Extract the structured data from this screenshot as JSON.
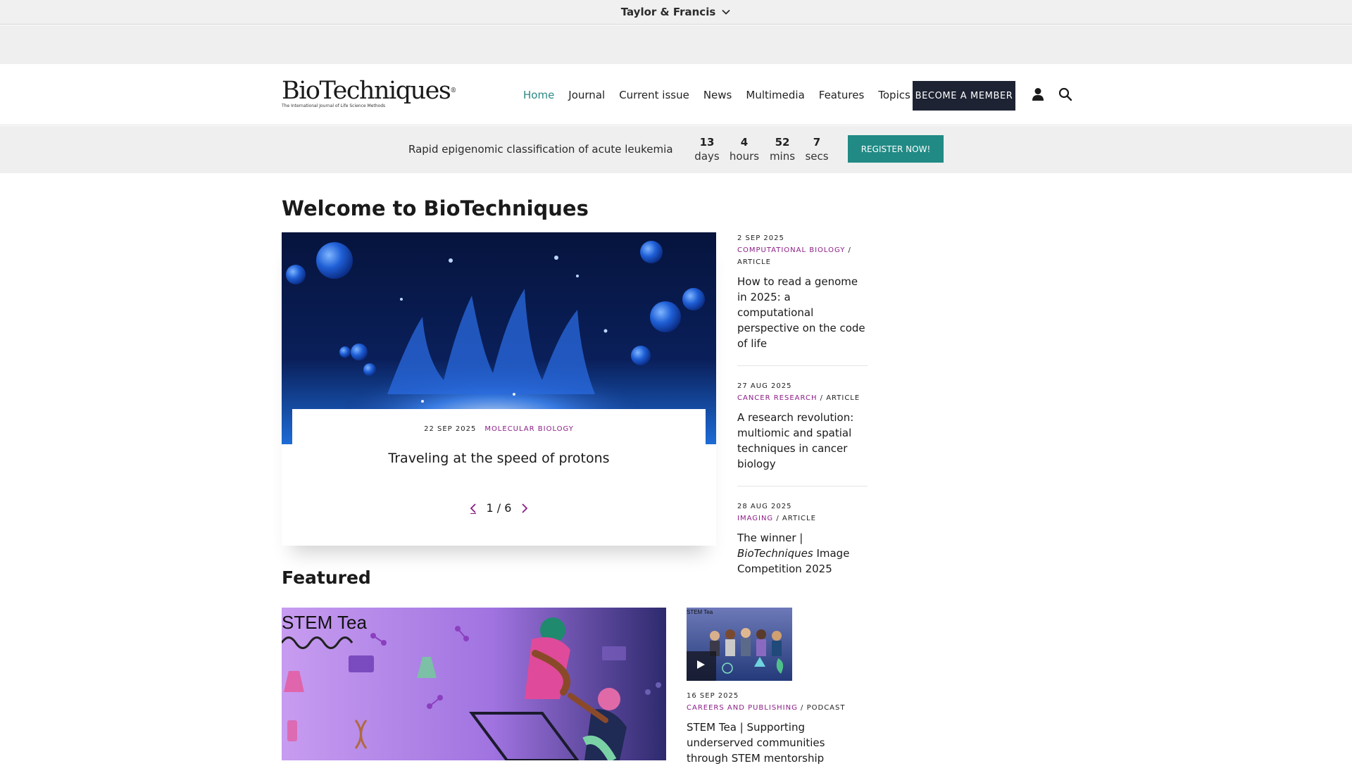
{
  "top_bar": {
    "publisher": "Taylor & Francis"
  },
  "header": {
    "logo_main": "BioTechniques",
    "logo_reg": "®",
    "logo_tagline": "The International Journal of Life Science Methods",
    "nav": [
      "Home",
      "Journal",
      "Current issue",
      "News",
      "Multimedia",
      "Features",
      "Topics"
    ],
    "active_nav": "Home",
    "member_button": "BECOME A MEMBER"
  },
  "promo": {
    "text": "Rapid epigenomic classification of acute leukemia",
    "countdown": [
      {
        "value": "13",
        "unit": "days"
      },
      {
        "value": "4",
        "unit": "hours"
      },
      {
        "value": "52",
        "unit": "mins"
      },
      {
        "value": "7",
        "unit": "secs"
      }
    ],
    "register_button": "REGISTER NOW!"
  },
  "welcome": {
    "heading": "Welcome to BioTechniques",
    "hero": {
      "date": "22 SEP 2025",
      "category": "MOLECULAR BIOLOGY",
      "title": "Traveling at the speed of protons",
      "pager": "1 / 6"
    },
    "side": [
      {
        "date": "2 SEP 2025",
        "category": "COMPUTATIONAL BIOLOGY",
        "type": "ARTICLE",
        "title": "How to read a genome in 2025: a computational perspective on the code of life"
      },
      {
        "date": "27 AUG 2025",
        "category": "CANCER RESEARCH",
        "type": "ARTICLE",
        "title": "A research revolution: multiomic and spatial techniques in cancer biology"
      },
      {
        "date": "28 AUG 2025",
        "category": "IMAGING",
        "type": "ARTICLE",
        "title_pre": "The winner | ",
        "title_em": "BioTechniques",
        "title_post": " Image Competition 2025"
      }
    ]
  },
  "featured": {
    "heading": "Featured",
    "image_text": "STEM Tea",
    "thumb_text": "STEM Tea",
    "item": {
      "date": "16 SEP 2025",
      "category": "CAREERS AND PUBLISHING",
      "type": "PODCAST",
      "title": "STEM Tea | Supporting underserved communities through STEM mentorship"
    }
  },
  "icons": [
    "chevron-down-icon",
    "user-icon",
    "search-icon",
    "chevron-left-icon",
    "chevron-right-icon",
    "play-icon"
  ],
  "colors": {
    "accent_teal": "#218a85",
    "category_purple": "#8b1d86",
    "dark_navy": "#1d2333"
  }
}
